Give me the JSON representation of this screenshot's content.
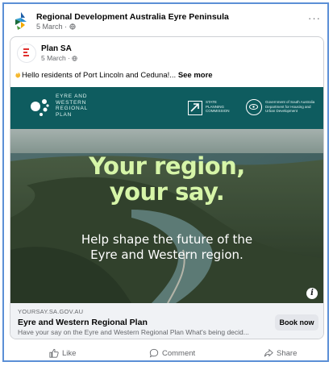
{
  "post": {
    "page_name": "Regional Development Australia Eyre Peninsula",
    "date": "5 March · ",
    "globe_icon": "globe-icon",
    "more": "···"
  },
  "shared_post": {
    "name": "Plan SA",
    "date": "5 March · ",
    "text": "Hello residents of Port Lincoln and Ceduna!... ",
    "see_more": "See more"
  },
  "ad_image": {
    "logo_lines": [
      "EYRE AND",
      "WESTERN",
      "REGIONAL",
      "PLAN"
    ],
    "state_planning": "STATE PLANNING COMMISSION",
    "government": "Government of South Australia Department for Housing and Urban Development",
    "headline_line1": "Your region,",
    "headline_line2": "your say.",
    "subline_line1": "Help shape the future of the",
    "subline_line2": "Eyre and Western region.",
    "info": "i"
  },
  "link": {
    "domain": "YOURSAY.SA.GOV.AU",
    "title": "Eyre and Western Regional Plan",
    "description": "Have your say on the Eyre and Western Regional Plan What's being decid...",
    "button": "Book now"
  },
  "actions": {
    "like": "Like",
    "comment": "Comment",
    "share": "Share"
  },
  "colors": {
    "frame_border": "#5b8fd6",
    "banner": "#0e5c5f",
    "headline": "#d6f5a8",
    "secondary_text": "#65676b"
  }
}
